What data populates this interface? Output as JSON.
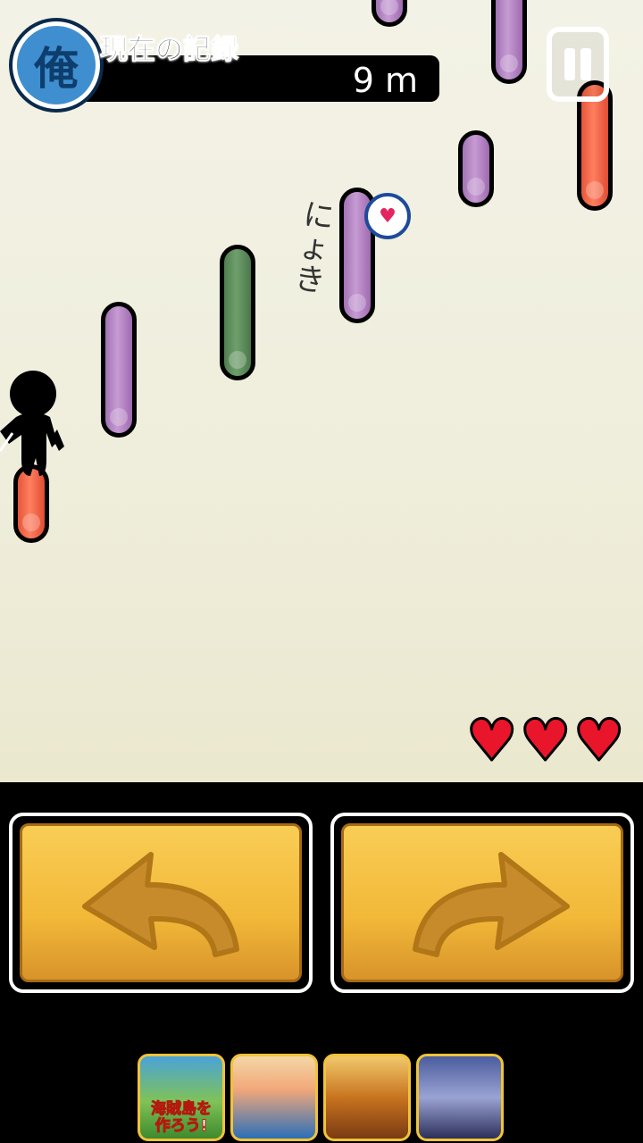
{
  "hud": {
    "badge_char": "俺",
    "record_label": "現在の記録",
    "record_value": "9 m"
  },
  "pause": {
    "icon": "pause-icon"
  },
  "effect_text": [
    "に",
    "ょ",
    "き"
  ],
  "pickup": {
    "icon": "heart-icon"
  },
  "lives": {
    "count": 3,
    "icon": "heart-icon",
    "color": "#e8152b"
  },
  "controls": {
    "left": {
      "icon": "curved-arrow-left-icon"
    },
    "right": {
      "icon": "curved-arrow-right-icon"
    }
  },
  "ads": [
    {
      "name": "ad-pirate-island",
      "text_line1": "海賊島を",
      "text_line2": "作ろう!"
    },
    {
      "name": "ad-mermaid",
      "text_line1": "",
      "text_line2": ""
    },
    {
      "name": "ad-lion-warrior",
      "text_line1": "",
      "text_line2": ""
    },
    {
      "name": "ad-samurai",
      "text_line1": "",
      "text_line2": ""
    }
  ],
  "colors": {
    "pillar_purple": "#b07fc0",
    "pillar_green": "#5e8b5a",
    "pillar_red": "#f0603f",
    "button_gold": "#f2b838"
  }
}
